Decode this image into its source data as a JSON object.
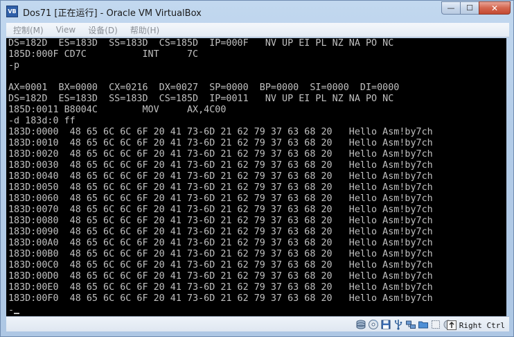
{
  "window": {
    "title": "Dos71 [正在运行] - Oracle VM VirtualBox",
    "icon_label": "VB",
    "controls": {
      "minimize_glyph": "—",
      "maximize_glyph": "☐",
      "close_glyph": "✕"
    }
  },
  "menu": {
    "items": [
      {
        "label": "控制(M)"
      },
      {
        "label": "View"
      },
      {
        "label": "设备(D)"
      },
      {
        "label": "帮助(H)"
      }
    ]
  },
  "console": {
    "lines": [
      "DS=182D  ES=183D  SS=183D  CS=185D  IP=000F   NV UP EI PL NZ NA PO NC",
      "185D:000F CD7C          INT     7C",
      "-p",
      "",
      "AX=0001  BX=0000  CX=0216  DX=0027  SP=0000  BP=0000  SI=0000  DI=0000",
      "DS=182D  ES=183D  SS=183D  CS=185D  IP=0011   NV UP EI PL NZ NA PO NC",
      "185D:0011 B8004C        MOV     AX,4C00",
      "-d 183d:0 ff",
      "183D:0000  48 65 6C 6C 6F 20 41 73-6D 21 62 79 37 63 68 20   Hello Asm!by7ch",
      "183D:0010  48 65 6C 6C 6F 20 41 73-6D 21 62 79 37 63 68 20   Hello Asm!by7ch",
      "183D:0020  48 65 6C 6C 6F 20 41 73-6D 21 62 79 37 63 68 20   Hello Asm!by7ch",
      "183D:0030  48 65 6C 6C 6F 20 41 73-6D 21 62 79 37 63 68 20   Hello Asm!by7ch",
      "183D:0040  48 65 6C 6C 6F 20 41 73-6D 21 62 79 37 63 68 20   Hello Asm!by7ch",
      "183D:0050  48 65 6C 6C 6F 20 41 73-6D 21 62 79 37 63 68 20   Hello Asm!by7ch",
      "183D:0060  48 65 6C 6C 6F 20 41 73-6D 21 62 79 37 63 68 20   Hello Asm!by7ch",
      "183D:0070  48 65 6C 6C 6F 20 41 73-6D 21 62 79 37 63 68 20   Hello Asm!by7ch",
      "183D:0080  48 65 6C 6C 6F 20 41 73-6D 21 62 79 37 63 68 20   Hello Asm!by7ch",
      "183D:0090  48 65 6C 6C 6F 20 41 73-6D 21 62 79 37 63 68 20   Hello Asm!by7ch",
      "183D:00A0  48 65 6C 6C 6F 20 41 73-6D 21 62 79 37 63 68 20   Hello Asm!by7ch",
      "183D:00B0  48 65 6C 6C 6F 20 41 73-6D 21 62 79 37 63 68 20   Hello Asm!by7ch",
      "183D:00C0  48 65 6C 6C 6F 20 41 73-6D 21 62 79 37 63 68 20   Hello Asm!by7ch",
      "183D:00D0  48 65 6C 6C 6F 20 41 73-6D 21 62 79 37 63 68 20   Hello Asm!by7ch",
      "183D:00E0  48 65 6C 6C 6F 20 41 73-6D 21 62 79 37 63 68 20   Hello Asm!by7ch",
      "183D:00F0  48 65 6C 6C 6F 20 41 73-6D 21 62 79 37 63 68 20   Hello Asm!by7ch"
    ],
    "prompt": "-"
  },
  "statusbar": {
    "icons": [
      {
        "name": "hard-disk-icon"
      },
      {
        "name": "optical-drive-icon"
      },
      {
        "name": "floppy-icon"
      },
      {
        "name": "usb-icon"
      },
      {
        "name": "network-icon"
      },
      {
        "name": "shared-folder-icon"
      },
      {
        "name": "capture-icon"
      },
      {
        "name": "mouse-integration-icon"
      },
      {
        "name": "host-key-arrow-icon"
      }
    ],
    "host_key_label": "Right Ctrl"
  },
  "colors": {
    "console_bg": "#000000",
    "console_fg": "#c0c0c0",
    "frame": "#b3cce8"
  }
}
